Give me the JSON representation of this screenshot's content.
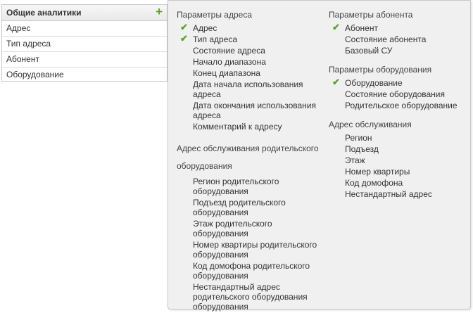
{
  "left_panel": {
    "title": "Общие аналитики",
    "add_icon": "plus-icon",
    "items": [
      "Адрес",
      "Тип адреса",
      "Абонент",
      "Оборудование"
    ]
  },
  "popup": {
    "address_params": {
      "title": "Параметры адреса",
      "items": [
        {
          "label": "Адрес",
          "checked": true
        },
        {
          "label": "Тип адреса",
          "checked": true
        },
        {
          "label": "Состояние адреса",
          "checked": false
        },
        {
          "label": "Начало диапазона",
          "checked": false
        },
        {
          "label": "Конец диапазона",
          "checked": false
        },
        {
          "label": "Дата начала использования адреса",
          "checked": false
        },
        {
          "label": "Дата окончания использования адреса",
          "checked": false
        },
        {
          "label": "Комментарий к адресу",
          "checked": false
        }
      ]
    },
    "parent_service_address": {
      "title": "Адрес обслуживания родительского оборудования",
      "items": [
        {
          "label": "Регион родительского оборудования",
          "checked": false
        },
        {
          "label": "Подъезд родительского оборудования",
          "checked": false
        },
        {
          "label": "Этаж родительского оборудования",
          "checked": false
        },
        {
          "label": "Номер квартиры родительского оборудования",
          "checked": false
        },
        {
          "label": "Код домофона родительского оборудования",
          "checked": false
        },
        {
          "label": "Нестандартный адрес родительского оборудования оборудования",
          "checked": false
        }
      ]
    },
    "subscriber_params": {
      "title": "Параметры абонента",
      "items": [
        {
          "label": "Абонент",
          "checked": true
        },
        {
          "label": "Состояние абонента",
          "checked": false
        },
        {
          "label": "Базовый СУ",
          "checked": false
        }
      ]
    },
    "equipment_params": {
      "title": "Параметры оборудования",
      "items": [
        {
          "label": "Оборудование",
          "checked": true
        },
        {
          "label": "Состояние оборудования",
          "checked": false
        },
        {
          "label": "Родительское оборудование",
          "checked": false
        }
      ]
    },
    "service_address": {
      "title": "Адрес обслуживания",
      "items": [
        {
          "label": "Регион",
          "checked": false
        },
        {
          "label": "Подъезд",
          "checked": false
        },
        {
          "label": "Этаж",
          "checked": false
        },
        {
          "label": "Номер квартиры",
          "checked": false
        },
        {
          "label": "Код домофона",
          "checked": false
        },
        {
          "label": "Нестандартный адрес",
          "checked": false
        }
      ]
    }
  },
  "colors": {
    "check": "#5aa02c",
    "popup_bg": "#f0f0f0",
    "border": "#c9c9c9"
  }
}
